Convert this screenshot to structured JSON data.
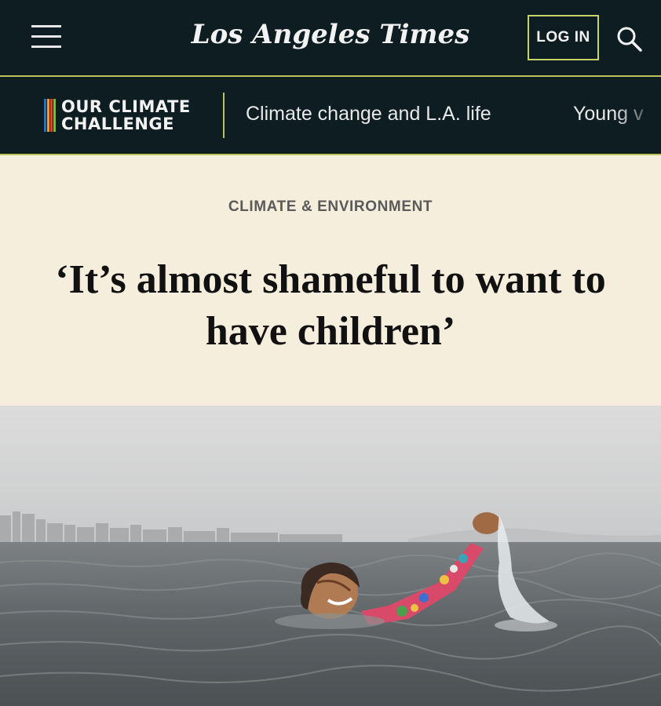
{
  "header": {
    "logo_text": "Los Angeles Times",
    "login_label": "LOG IN",
    "menu_icon": "hamburger-menu-icon",
    "search_icon": "search-icon"
  },
  "subnav": {
    "section_logo_line1": "OUR CLIMATE",
    "section_logo_line2": "CHALLENGE",
    "links": [
      "Climate change and L.A. life",
      "Young v"
    ]
  },
  "article": {
    "kicker": "CLIMATE & ENVIRONMENT",
    "headline": "‘It’s almost shameful to want to have children’"
  },
  "colors": {
    "header_bg": "#0d1d22",
    "accent_line": "#b9c35a",
    "page_bg": "#f6eedd"
  }
}
